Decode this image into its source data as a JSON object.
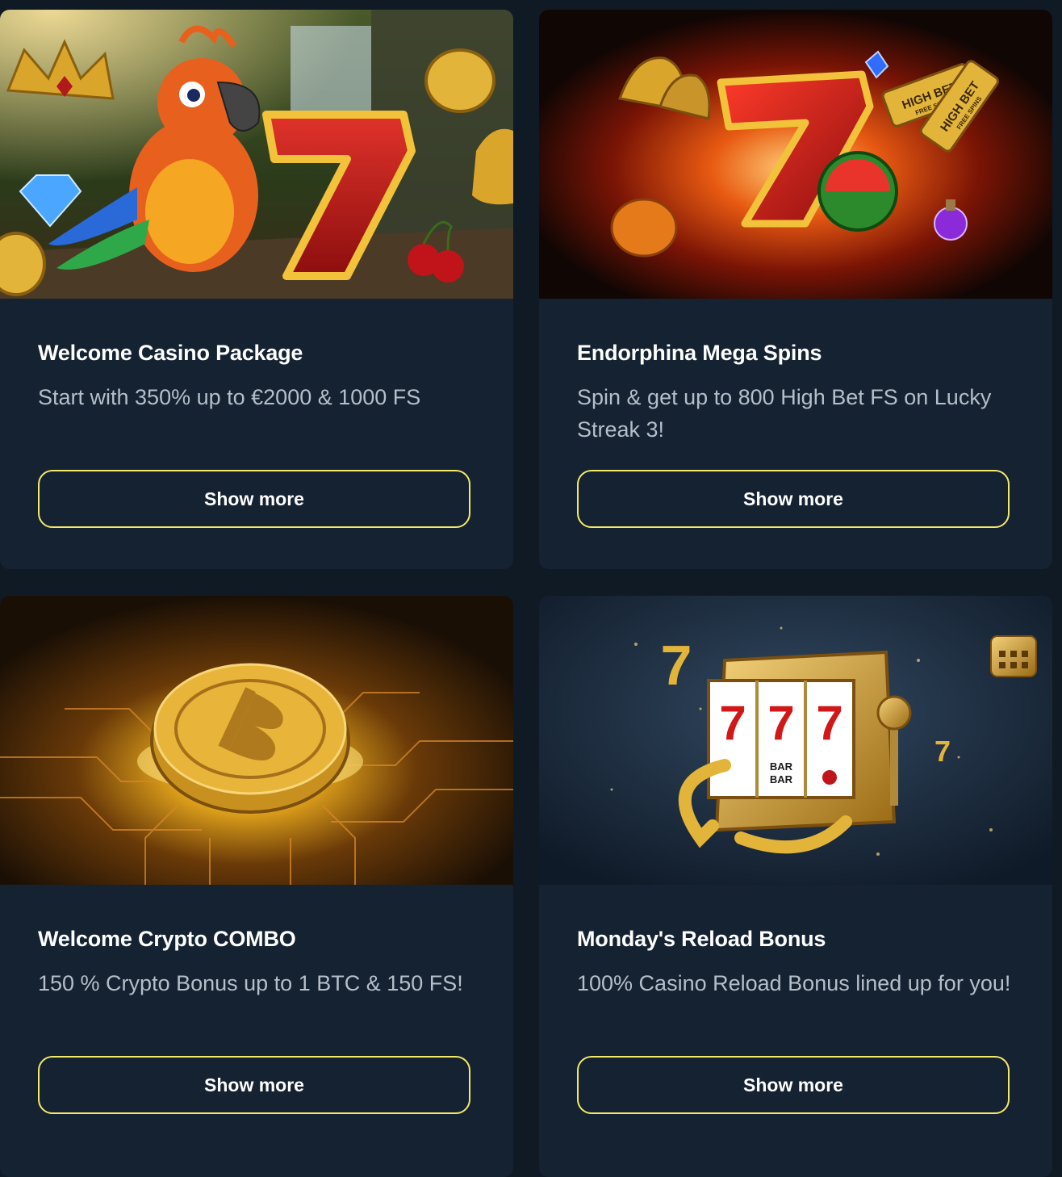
{
  "promotions": [
    {
      "title": "Welcome Casino Package",
      "description": "Start with 350% up to €2000 & 1000 FS",
      "button_label": "Show more",
      "image_theme": "parrot-lucky-seven"
    },
    {
      "title": "Endorphina Mega Spins",
      "description": "Spin & get up to 800 High Bet FS on Lucky Streak 3!",
      "button_label": "Show more",
      "image_theme": "flaming-seven-high-bet",
      "image_text": [
        "HIGH BET",
        "FREE SPINS",
        "HIGH BET",
        "FREE SPINS"
      ]
    },
    {
      "title": "Welcome Crypto COMBO",
      "description": "150 % Crypto Bonus up to 1 BTC & 150 FS!",
      "button_label": "Show more",
      "image_theme": "gold-bitcoin-circuit"
    },
    {
      "title": "Monday's Reload Bonus",
      "description": "100% Casino Reload Bonus lined up for you!",
      "button_label": "Show more",
      "image_theme": "gold-slot-machine",
      "image_text": [
        "7",
        "7",
        "7",
        "BAR",
        "BAR",
        "7",
        "7"
      ]
    }
  ],
  "colors": {
    "page_bg": "#0f1a24",
    "card_bg": "#142232",
    "button_border": "#f5e96a",
    "title": "#ffffff",
    "description": "#b5bfc9"
  }
}
